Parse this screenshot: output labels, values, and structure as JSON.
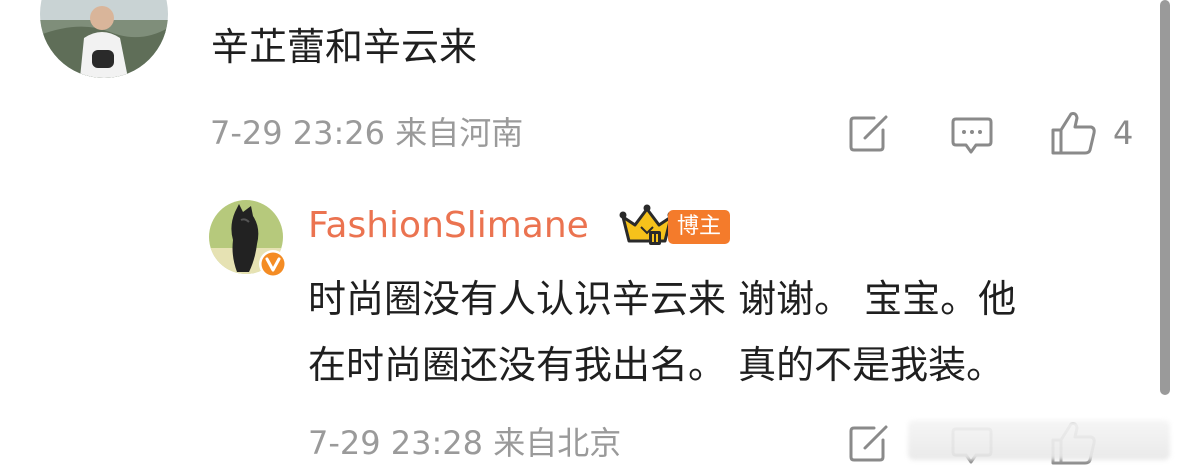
{
  "top_comment": {
    "text": "辛芷蕾和辛云来",
    "time": "7-29 23:26",
    "location": "来自河南",
    "like_count": "4"
  },
  "reply": {
    "username": "FashionSlimane",
    "host_badge": "博主",
    "line1": "时尚圈没有人认识辛云来 谢谢。 宝宝。他",
    "line2": "在时尚圈还没有我出名。 真的不是我装。",
    "time": "7-29 23:28",
    "location": "来自北京"
  },
  "colors": {
    "username": "#eb7350",
    "meta_text": "#9a9a9a",
    "badge": "#f47b2b",
    "verify": "#f48c24",
    "icon": "#8a8a8a"
  },
  "icons": {
    "repost": "repost-icon",
    "comment": "comment-icon",
    "like": "like-icon",
    "crown": "crown-icon",
    "verified": "verified-icon"
  }
}
